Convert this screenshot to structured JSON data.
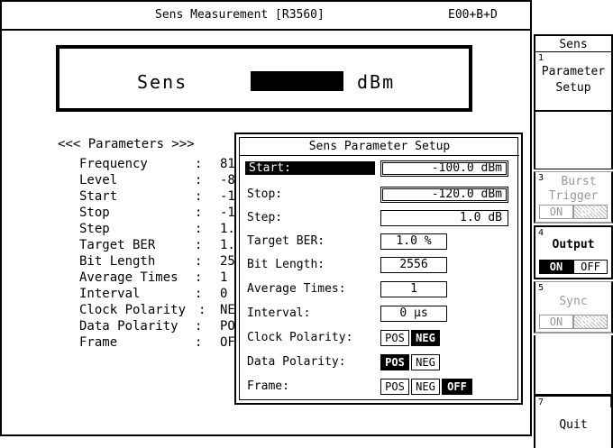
{
  "window": {
    "title": "Sens Measurement [R3560]",
    "code": "E00+B+D"
  },
  "display": {
    "label": "Sens",
    "unit": "dBm"
  },
  "parameters": {
    "heading": "<<< Parameters >>>",
    "items": [
      {
        "label": "Frequency",
        "value": "81"
      },
      {
        "label": "Level",
        "value": "-8"
      },
      {
        "label": "Start",
        "value": "-1"
      },
      {
        "label": "Stop",
        "value": "-1"
      },
      {
        "label": "Step",
        "value": "1."
      },
      {
        "label": "Target BER",
        "value": "1."
      },
      {
        "label": "Bit Length",
        "value": "25"
      },
      {
        "label": "Average Times",
        "value": "1"
      },
      {
        "label": "Interval",
        "value": "0"
      },
      {
        "label": "Clock Polarity",
        "value": "NE"
      },
      {
        "label": "Data Polarity",
        "value": "PO"
      },
      {
        "label": "Frame",
        "value": "OF"
      }
    ]
  },
  "dialog": {
    "title": "Sens Parameter Setup",
    "start_label": "Start:",
    "start_value": "-100.0 dBm",
    "stop_label": "Stop:",
    "stop_value": "-120.0 dBm",
    "step_label": "Step:",
    "step_value": "1.0 dB",
    "ber_label": "Target BER:",
    "ber_value": "1.0 %",
    "bitlen_label": "Bit Length:",
    "bitlen_value": "2556",
    "avg_label": "Average Times:",
    "avg_value": "1",
    "interval_label": "Interval:",
    "interval_value": "0 µs",
    "clock_label": "Clock Polarity:",
    "clock_pos": "POS",
    "clock_neg": "NEG",
    "data_label": "Data Polarity:",
    "data_pos": "POS",
    "data_neg": "NEG",
    "frame_label": "Frame:",
    "frame_pos": "POS",
    "frame_neg": "NEG",
    "frame_off": "OFF"
  },
  "softkeys": {
    "header": "Sens",
    "k1": {
      "num": "1",
      "line1": "Parameter",
      "line2": "Setup"
    },
    "k3": {
      "num": "3",
      "line1": "Burst",
      "line2": "Trigger",
      "on": "ON",
      "off": "OFF"
    },
    "k4": {
      "num": "4",
      "line1": "Output",
      "on": "ON",
      "off": "OFF"
    },
    "k5": {
      "num": "5",
      "line1": "Sync",
      "on": "ON",
      "off": "OFF"
    },
    "k7": {
      "num": "7",
      "line1": "Quit"
    }
  }
}
